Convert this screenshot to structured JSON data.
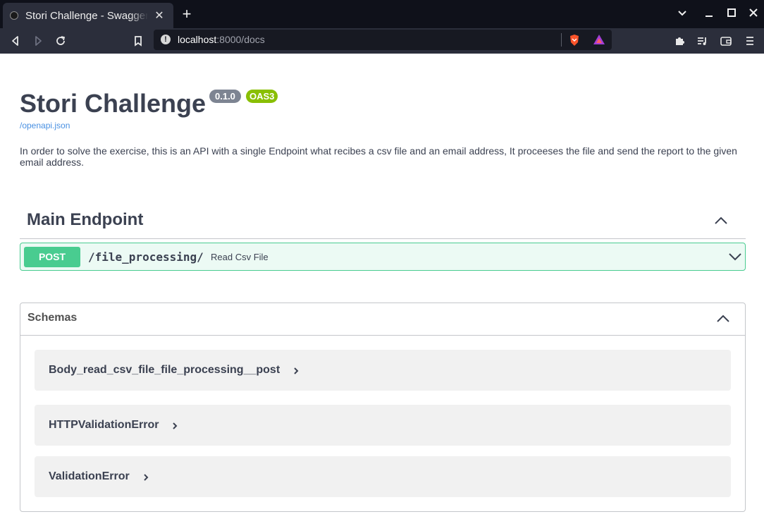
{
  "browser": {
    "tab_title": "Stori Challenge - Swagger UI",
    "tab_close": "✕",
    "new_tab": "+",
    "url_host": "localhost",
    "url_rest": ":8000/docs"
  },
  "page": {
    "title": "Stori Challenge",
    "version": "0.1.0",
    "oas_badge": "OAS3",
    "spec_link": "/openapi.json",
    "description": "In order to solve the exercise, this is an API with a single Endpoint what recibes a csv file and an email address, It proceeses the file and send the report to the given email address."
  },
  "tag": {
    "name": "Main Endpoint"
  },
  "operation": {
    "method": "POST",
    "path": "/file_processing/",
    "summary": "Read Csv File"
  },
  "schemas": {
    "title": "Schemas",
    "items": [
      "Body_read_csv_file_file_processing__post",
      "HTTPValidationError",
      "ValidationError"
    ]
  },
  "colors": {
    "post": "#49cc90",
    "version_badge": "#7d8492",
    "oas_badge": "#89bf04",
    "link": "#4990e2"
  }
}
